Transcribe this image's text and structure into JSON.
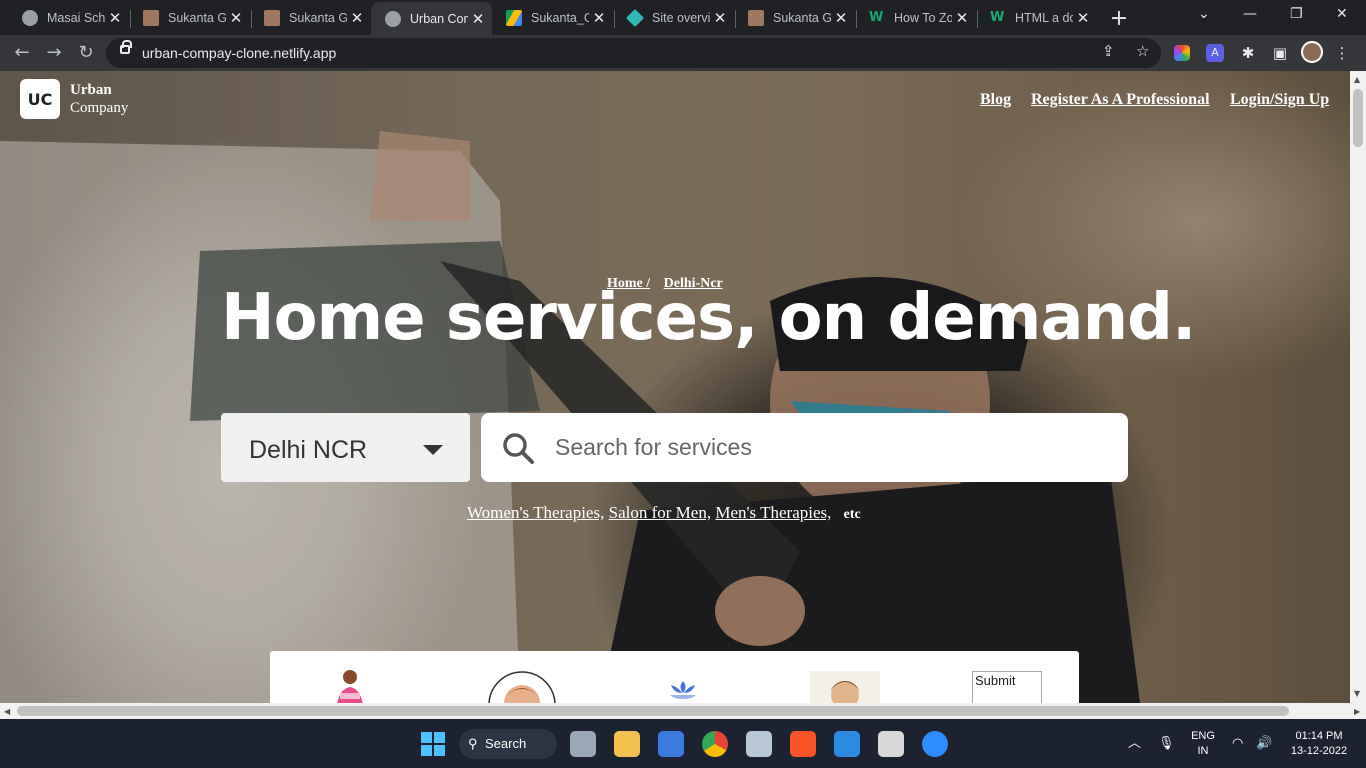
{
  "browser": {
    "tabs": [
      {
        "label": "Masai School",
        "icon": "globe-icon",
        "color": "#9aa0a6"
      },
      {
        "label": "Sukanta Ghosh",
        "icon": "profile-photo-icon",
        "color": "#a07860"
      },
      {
        "label": "Sukanta Ghosh",
        "icon": "profile-photo-icon",
        "color": "#a07860"
      },
      {
        "label": "Urban Company",
        "icon": "globe-icon",
        "color": "#9aa0a6"
      },
      {
        "label": "Sukanta_Ghosh",
        "icon": "google-drive-icon",
        "color": "#fbbc04"
      },
      {
        "label": "Site overview",
        "icon": "netlify-icon",
        "color": "#2fb7b7"
      },
      {
        "label": "Sukanta Ghosh",
        "icon": "profile-photo-icon",
        "color": "#a07860"
      },
      {
        "label": "How To Zoom",
        "icon": "w-icon",
        "color": "#19a974"
      },
      {
        "label": "HTML a download",
        "icon": "w-icon",
        "color": "#19a974"
      }
    ],
    "active_tab_index": 3,
    "url": "urban-compay-clone.netlify.app"
  },
  "site": {
    "logo_mark": "UC",
    "logo_line1": "Urban",
    "logo_line2": "Company",
    "nav": {
      "blog": "Blog",
      "register": "Register As A Professional",
      "login": "Login/Sign Up"
    },
    "breadcrumb": {
      "home": "Home /",
      "city": "Delhi-Ncr"
    },
    "headline": "Home services, on demand.",
    "city_select": "Delhi NCR",
    "search_placeholder": "Search for services",
    "popular": {
      "items": [
        "Women's Therapies,",
        "Salon for Men,",
        "Men's Therapies,"
      ],
      "etc": "etc"
    },
    "broken_image_alt": "Submit"
  },
  "taskbar": {
    "search_label": "Search",
    "language_top": "ENG",
    "language_bottom": "IN",
    "time": "01:14 PM",
    "date": "13-12-2022"
  }
}
